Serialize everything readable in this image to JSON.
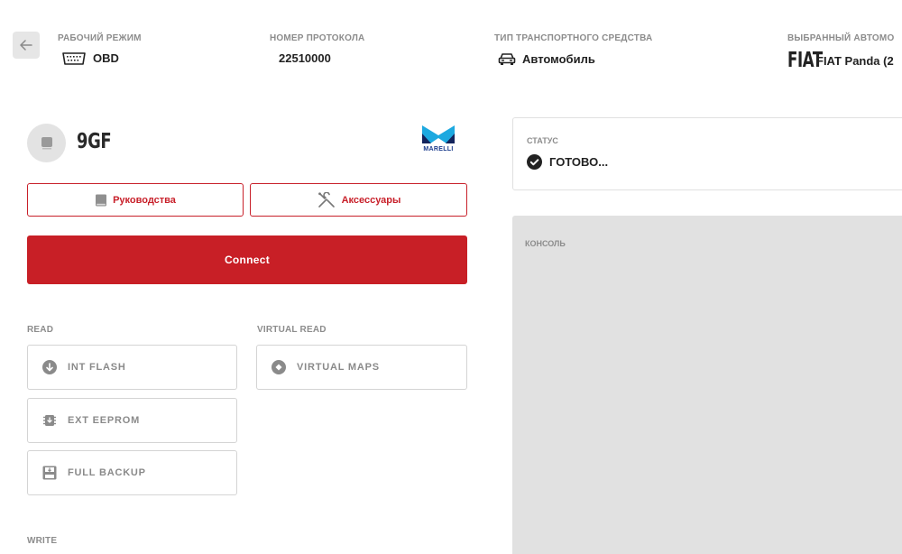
{
  "header": {
    "working_mode": {
      "label": "РАБОЧИЙ РЕЖИМ",
      "value": "OBD",
      "icon": "obd-connector-icon"
    },
    "protocol": {
      "label": "НОМЕР ПРОТОКОЛА",
      "value": "22510000"
    },
    "vehicle_type": {
      "label": "ТИП ТРАНСПОРТНОГО СРЕДСТВА",
      "value": "Автомобиль",
      "icon": "car-icon"
    },
    "selected_vehicle": {
      "label": "ВЫБРАННЫЙ АВТОМО",
      "value": "FIAT Panda (2",
      "brand_logo": "FIAT"
    }
  },
  "ecu": {
    "name": "9GF",
    "brand": "MARELLI",
    "manuals_label": "Руководства",
    "accessories_label": "Аксессуары",
    "connect_label": "Connect"
  },
  "read": {
    "label": "READ",
    "items": [
      {
        "label": "INT FLASH",
        "icon": "download-icon"
      },
      {
        "label": "EXT EEPROM",
        "icon": "chip-icon"
      },
      {
        "label": "FULL BACKUP",
        "icon": "save-icon"
      }
    ]
  },
  "virtual_read": {
    "label": "VIRTUAL READ",
    "items": [
      {
        "label": "VIRTUAL MAPS",
        "icon": "virtual-icon"
      }
    ]
  },
  "write": {
    "label": "WRITE"
  },
  "status": {
    "label": "СТАТУС",
    "value": "ГОТОВО..."
  },
  "console": {
    "label": "КОНСОЛЬ"
  },
  "colors": {
    "accent": "#c81f26",
    "marelli_blue": "#1da9e0",
    "console_bg": "#e1e1e1"
  }
}
